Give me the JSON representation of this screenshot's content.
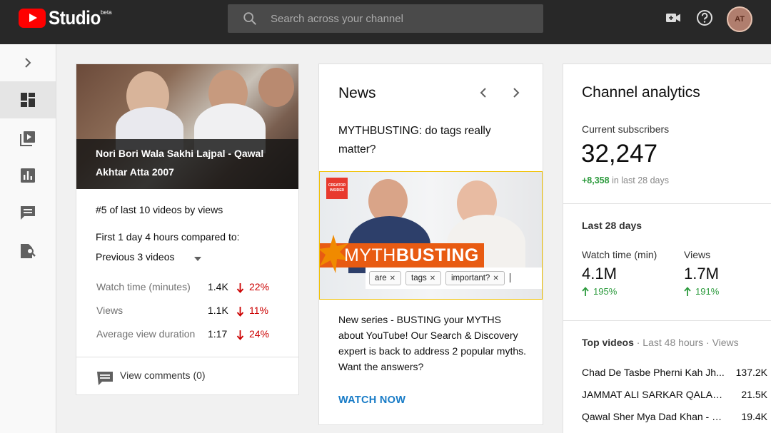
{
  "header": {
    "logo_text": "Studio",
    "beta_label": "beta",
    "search_placeholder": "Search across your channel",
    "avatar_initials": "AT"
  },
  "sidebar": {
    "items": [
      {
        "name": "expand",
        "icon": "chevron-right-icon",
        "active": false
      },
      {
        "name": "dashboard",
        "icon": "dashboard-icon",
        "active": true
      },
      {
        "name": "videos",
        "icon": "video-library-icon",
        "active": false
      },
      {
        "name": "analytics",
        "icon": "analytics-icon",
        "active": false
      },
      {
        "name": "comments",
        "icon": "comments-icon",
        "active": false
      },
      {
        "name": "copyright",
        "icon": "copyright-search-icon",
        "active": false
      }
    ]
  },
  "latest_video": {
    "title": "Nori Bori Wala Sakhi Lajpal - Qawal Akhtar Atta 2007",
    "rank": "#5 of last 10 videos by views",
    "compared_label": "First 1 day 4 hours compared to:",
    "compare_option": "Previous 3 videos",
    "metrics": [
      {
        "label": "Watch time (minutes)",
        "value": "1.4K",
        "change": "22%"
      },
      {
        "label": "Views",
        "value": "1.1K",
        "change": "11%"
      },
      {
        "label": "Average view duration",
        "value": "1:17",
        "change": "24%"
      }
    ],
    "comments_link": "View comments (0)"
  },
  "news": {
    "title": "News",
    "headline": "MYTHBUSTING: do tags really matter?",
    "image_banner_prefix": "MYTH",
    "image_banner_bold": "BUSTING",
    "image_badge": "CREATOR INSIDER",
    "image_tags": [
      "are",
      "tags",
      "important?"
    ],
    "description": "New series - BUSTING your MYTHS about YouTube! Our Search & Discovery expert is back to address 2 popular myths. Want the answers?",
    "cta": "WATCH NOW"
  },
  "analytics": {
    "title": "Channel analytics",
    "subscribers_label": "Current subscribers",
    "subscribers_value": "32,247",
    "subscribers_delta": "+8,358",
    "subscribers_delta_suffix": "in last 28 days",
    "period_label": "Last 28 days",
    "stats": [
      {
        "label": "Watch time (min)",
        "value": "4.1M",
        "change": "195%"
      },
      {
        "label": "Views",
        "value": "1.7M",
        "change": "191%"
      }
    ],
    "top_videos_label": "Top videos",
    "top_videos_meta": " · Last 48 hours · Views",
    "top_videos": [
      {
        "title": "Chad De Tasbe Pherni Kah Jh...",
        "views": "137.2K"
      },
      {
        "title": "JAMMAT ALI SARKAR QALAN...",
        "views": "21.5K"
      },
      {
        "title": "Qawal Sher Mya Dad Khan - M...",
        "views": "19.4K"
      }
    ]
  },
  "colors": {
    "topbar": "#282828",
    "brand_red": "#ff0000",
    "negative": "#cc0000",
    "positive": "#2b9a3c",
    "link": "#167ac6"
  }
}
